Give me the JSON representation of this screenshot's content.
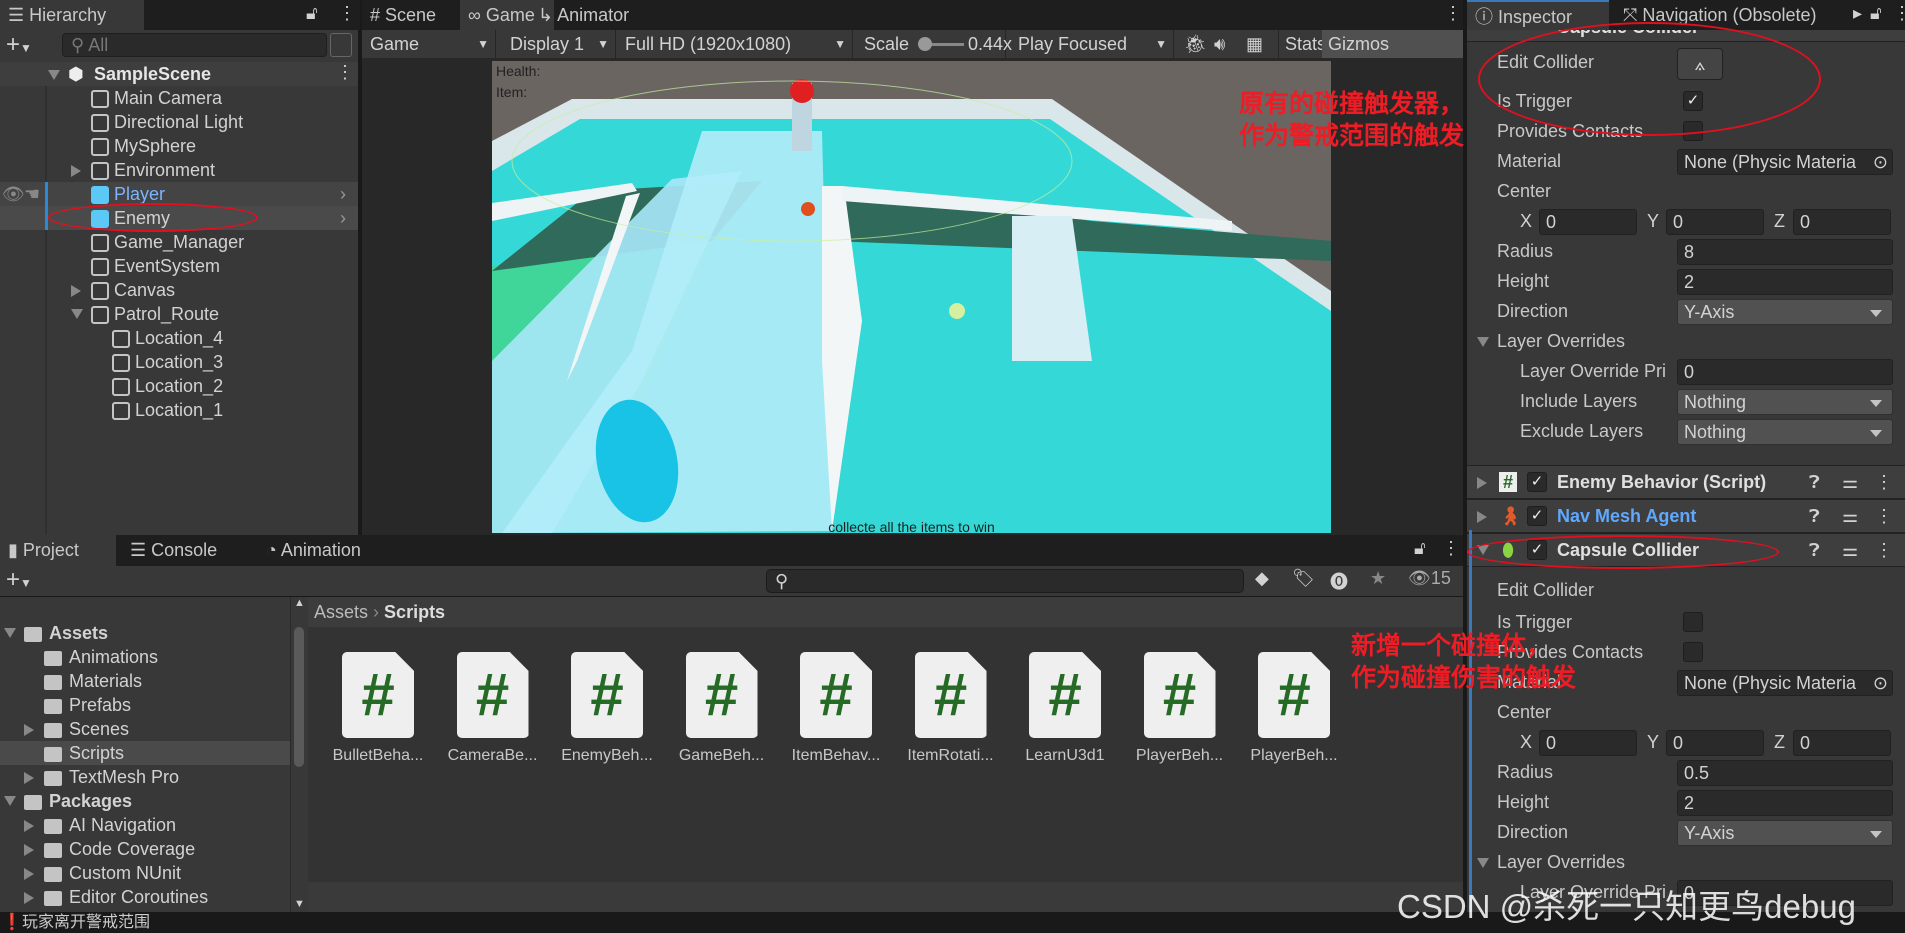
{
  "hierarchy": {
    "tab": "Hierarchy",
    "search_placeholder": "All",
    "scene": "SampleScene",
    "items": [
      {
        "label": "Main Camera",
        "depth": 0,
        "expander": "none"
      },
      {
        "label": "Directional Light",
        "depth": 0,
        "expander": "none"
      },
      {
        "label": "MySphere",
        "depth": 0,
        "expander": "none"
      },
      {
        "label": "Environment",
        "depth": 0,
        "expander": "collapsed"
      },
      {
        "label": "Player",
        "depth": 0,
        "expander": "none",
        "prefab": true,
        "highlight": "player"
      },
      {
        "label": "Enemy",
        "depth": 0,
        "expander": "none",
        "prefab": true,
        "highlight": "selected"
      },
      {
        "label": "Game_Manager",
        "depth": 0,
        "expander": "none"
      },
      {
        "label": "EventSystem",
        "depth": 0,
        "expander": "none"
      },
      {
        "label": "Canvas",
        "depth": 0,
        "expander": "collapsed"
      },
      {
        "label": "Patrol_Route",
        "depth": 0,
        "expander": "expanded"
      },
      {
        "label": "Location_4",
        "depth": 1,
        "expander": "none"
      },
      {
        "label": "Location_3",
        "depth": 1,
        "expander": "none"
      },
      {
        "label": "Location_2",
        "depth": 1,
        "expander": "none"
      },
      {
        "label": "Location_1",
        "depth": 1,
        "expander": "none"
      }
    ]
  },
  "center_tabs": [
    {
      "label": "Scene",
      "icon": "grid-icon"
    },
    {
      "label": "Game",
      "icon": "gamepad-icon",
      "active": true
    },
    {
      "label": "Animator",
      "icon": "animator-icon"
    }
  ],
  "game_toolbar": {
    "mode": "Game",
    "display": "Display 1",
    "resolution": "Full HD (1920x1080)",
    "scale_label": "Scale",
    "scale_value": "0.44x",
    "play_mode": "Play Focused",
    "stats": "Stats",
    "gizmos": "Gizmos"
  },
  "game_view": {
    "health_label": "Health:",
    "item_label": "Item:",
    "message": "collecte all the items to win"
  },
  "inspector": {
    "tabs": [
      "Inspector",
      "Navigation (Obsolete)"
    ],
    "top_component": "Capsule Collider",
    "labels": {
      "edit_collider": "Edit Collider",
      "is_trigger": "Is Trigger",
      "provides_contacts": "Provides Contacts",
      "material": "Material",
      "center": "Center",
      "radius": "Radius",
      "height": "Height",
      "direction": "Direction",
      "layer_overrides": "Layer Overrides",
      "layer_override_priority": "Layer Override Pri",
      "include_layers": "Include Layers",
      "exclude_layers": "Exclude Layers",
      "x": "X",
      "y": "Y",
      "z": "Z"
    },
    "colliders": [
      {
        "is_trigger": true,
        "provides_contacts": false,
        "material": "None (Physic Materia",
        "center": [
          "0",
          "0",
          "0"
        ],
        "radius": "8",
        "height": "2",
        "direction": "Y-Axis",
        "layer_override_priority": "0",
        "include_layers": "Nothing",
        "exclude_layers": "Nothing"
      },
      {
        "is_trigger": false,
        "provides_contacts": false,
        "material": "None (Physic Materia",
        "center": [
          "0",
          "0",
          "0"
        ],
        "radius": "0.5",
        "height": "2",
        "direction": "Y-Axis",
        "layer_override_priority": "0"
      }
    ],
    "components": [
      {
        "title": "Enemy Behavior (Script)",
        "icon": "csharp-script-icon",
        "enabled": true
      },
      {
        "title": "Nav Mesh Agent",
        "icon": "nav-mesh-agent-icon",
        "enabled": true,
        "color": "#5fa8ff"
      },
      {
        "title": "Capsule Collider",
        "icon": "capsule-collider-icon",
        "enabled": true
      }
    ]
  },
  "bottom_tabs": [
    {
      "label": "Project",
      "icon": "folder-icon",
      "active": true
    },
    {
      "label": "Console",
      "icon": "console-icon"
    },
    {
      "label": "Animation",
      "icon": "clock-icon"
    }
  ],
  "project": {
    "hidden_count": "15",
    "tree": [
      {
        "label": "Assets",
        "depth": 0,
        "expander": "expanded",
        "bold": true,
        "open": true
      },
      {
        "label": "Animations",
        "depth": 1,
        "expander": "none"
      },
      {
        "label": "Materials",
        "depth": 1,
        "expander": "none"
      },
      {
        "label": "Prefabs",
        "depth": 1,
        "expander": "none"
      },
      {
        "label": "Scenes",
        "depth": 1,
        "expander": "collapsed"
      },
      {
        "label": "Scripts",
        "depth": 1,
        "expander": "none",
        "selected": true
      },
      {
        "label": "TextMesh Pro",
        "depth": 1,
        "expander": "collapsed"
      },
      {
        "label": "Packages",
        "depth": 0,
        "expander": "expanded",
        "bold": true,
        "open": true
      },
      {
        "label": "AI Navigation",
        "depth": 1,
        "expander": "collapsed"
      },
      {
        "label": "Code Coverage",
        "depth": 1,
        "expander": "collapsed"
      },
      {
        "label": "Custom NUnit",
        "depth": 1,
        "expander": "collapsed"
      },
      {
        "label": "Editor Coroutines",
        "depth": 1,
        "expander": "collapsed"
      }
    ],
    "breadcrumb": [
      "Assets",
      "Scripts"
    ],
    "files": [
      "BulletBeha...",
      "CameraBe...",
      "EnemyBeh...",
      "GameBeh...",
      "ItemBehav...",
      "ItemRotati...",
      "LearnU3d1",
      "PlayerBeh...",
      "PlayerBeh..."
    ]
  },
  "status_bar": {
    "message": "玩家离开警戒范围"
  },
  "annotations": {
    "note1": [
      "原有的碰撞触发器，",
      "作为警戒范围的触发"
    ],
    "note2": [
      "新增一个碰撞体，",
      "作为碰撞伤害的触发"
    ],
    "color": "#ee1c25"
  },
  "watermark": "CSDN @杀死一只知更鸟debug"
}
